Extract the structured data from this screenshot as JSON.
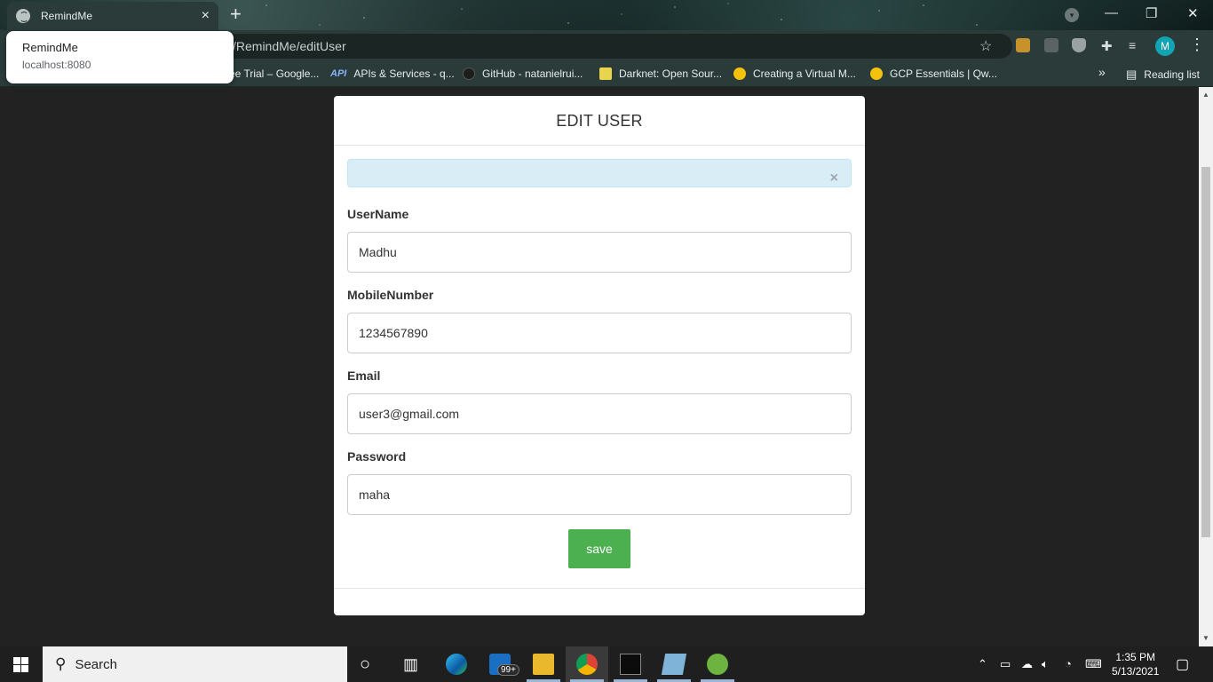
{
  "browser": {
    "tab_title": "RemindMe",
    "tab_close": "×",
    "new_tab": "+",
    "url": "/RemindMe/editUser",
    "reading_list": "Reading list",
    "bookmarks_overflow": "»",
    "profile_initial": "M",
    "window_controls": {
      "minimize": "—",
      "restore": "❐",
      "close": "✕"
    },
    "bookmarks": [
      {
        "label": "ee Trial – Google...",
        "icon": "google-cloud-icon"
      },
      {
        "label": "APIs & Services - q...",
        "icon": "api-icon",
        "prefix": "API"
      },
      {
        "label": "GitHub - natanielrui...",
        "icon": "github-icon"
      },
      {
        "label": "Darknet: Open Sour...",
        "icon": "darknet-icon"
      },
      {
        "label": "Creating a Virtual M...",
        "icon": "qwiklabs-icon"
      },
      {
        "label": "GCP Essentials | Qw...",
        "icon": "qwiklabs-icon"
      }
    ]
  },
  "tooltip": {
    "title": "RemindMe",
    "host": "localhost:8080"
  },
  "modal": {
    "title": "EDIT USER",
    "alert_close": "×",
    "fields": {
      "username": {
        "label": "UserName",
        "value": "Madhu"
      },
      "mobile": {
        "label": "MobileNumber",
        "value": "1234567890"
      },
      "email": {
        "label": "Email",
        "value": "user3@gmail.com"
      },
      "password": {
        "label": "Password",
        "value": "maha"
      }
    },
    "save_label": "save"
  },
  "taskbar": {
    "search_placeholder": "Search",
    "mail_badge": "99+",
    "time": "1:35 PM",
    "date": "5/13/2021"
  },
  "colors": {
    "save_button": "#4caf50",
    "alert_bg": "#d9edf7",
    "page_bg": "#222222",
    "browser_chrome": "#2b3b3a"
  }
}
